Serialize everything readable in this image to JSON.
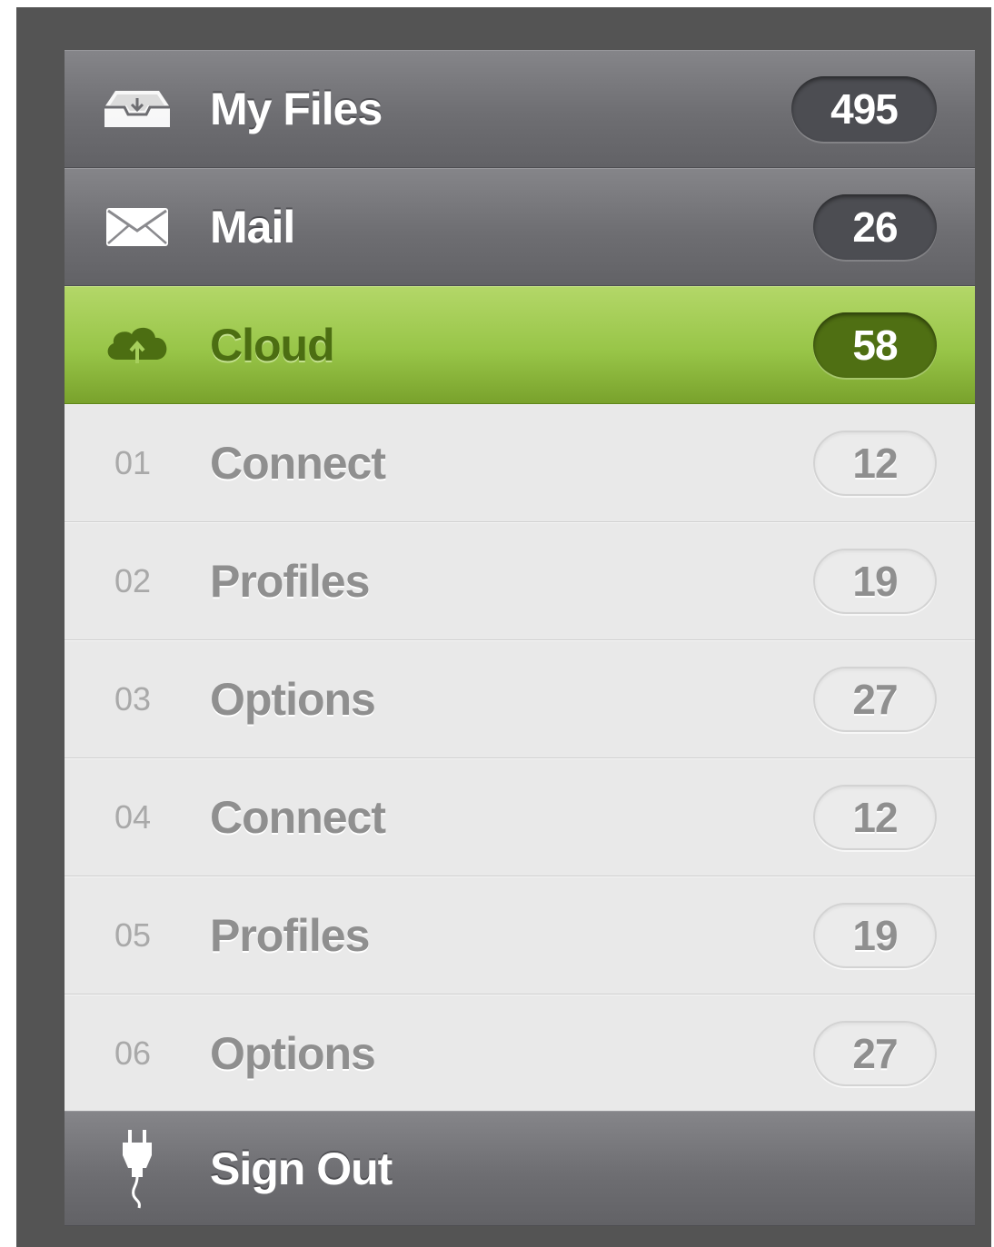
{
  "menu": {
    "my_files": {
      "label": "My Files",
      "count": "495",
      "icon": "inbox-tray-icon"
    },
    "mail": {
      "label": "Mail",
      "count": "26",
      "icon": "envelope-icon"
    },
    "cloud": {
      "label": "Cloud",
      "count": "58",
      "icon": "cloud-upload-icon",
      "active": true
    },
    "sub_items": [
      {
        "number": "01",
        "label": "Connect",
        "count": "12"
      },
      {
        "number": "02",
        "label": "Profiles",
        "count": "19"
      },
      {
        "number": "03",
        "label": "Options",
        "count": "27"
      },
      {
        "number": "04",
        "label": "Connect",
        "count": "12"
      },
      {
        "number": "05",
        "label": "Profiles",
        "count": "19"
      },
      {
        "number": "06",
        "label": "Options",
        "count": "27"
      }
    ],
    "sign_out": {
      "label": "Sign Out",
      "icon": "power-plug-icon"
    }
  },
  "colors": {
    "frame": "#545454",
    "dark_row": "#6e6e72",
    "active_row": "#98c548",
    "active_text": "#4c6e12",
    "sub_row": "#e9e9e9",
    "sub_text": "#8f8f8f"
  }
}
